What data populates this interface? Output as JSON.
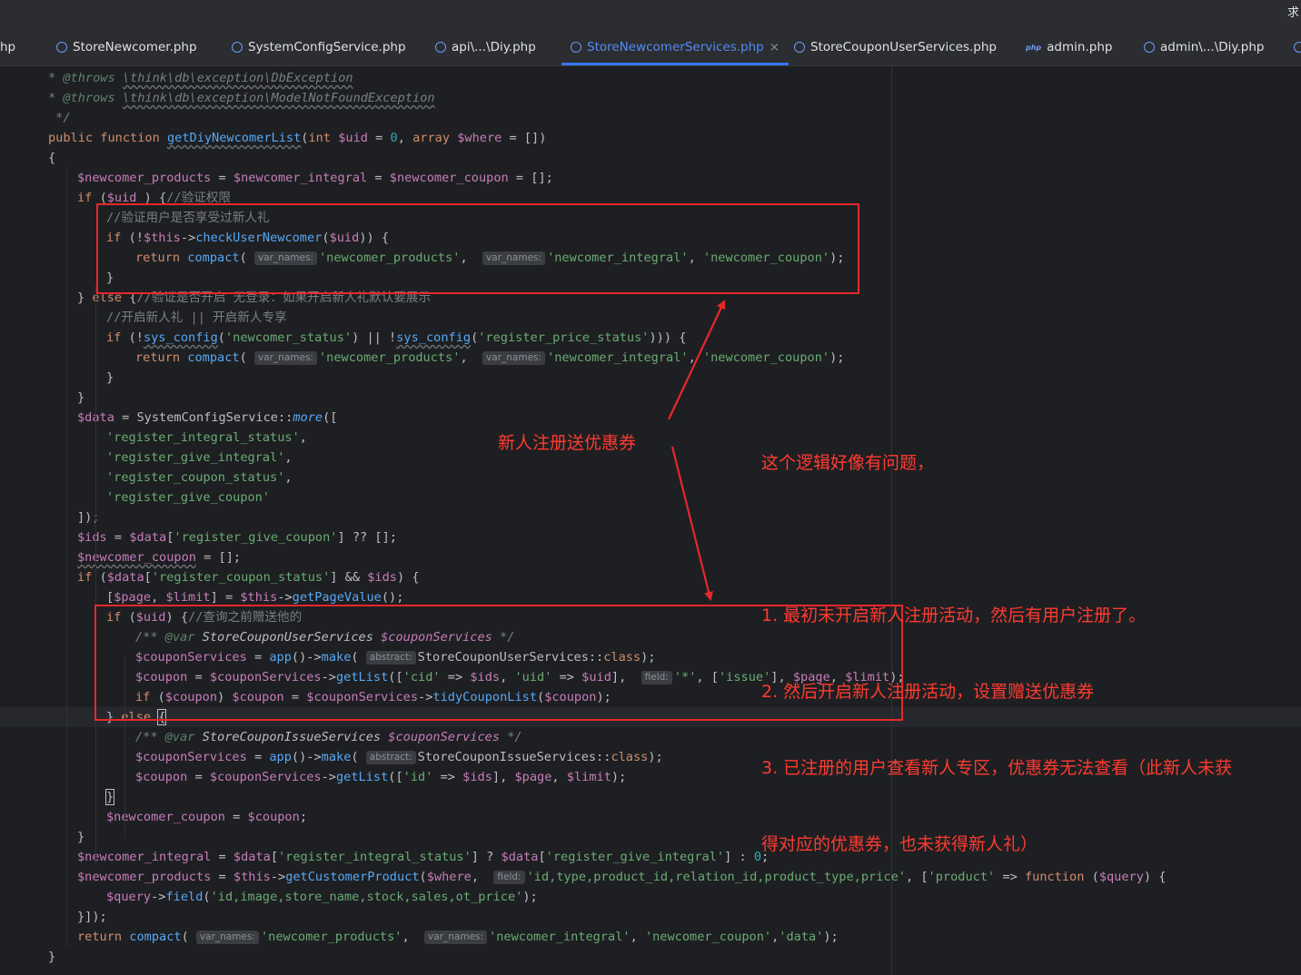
{
  "window": {
    "corner_glyph": "求"
  },
  "tabs": [
    {
      "label": "hp",
      "icon": "",
      "active": false
    },
    {
      "label": "StoreNewcomer.php",
      "icon": "php-class-icon",
      "active": false
    },
    {
      "label": "SystemConfigService.php",
      "icon": "php-class-icon",
      "active": false
    },
    {
      "label": "api\\...\\Diy.php",
      "icon": "php-class-icon",
      "active": false
    },
    {
      "label": "StoreNewcomerServices.php",
      "icon": "php-class-icon",
      "active": true,
      "close": "×"
    },
    {
      "label": "StoreCouponUserServices.php",
      "icon": "php-class-icon",
      "active": false
    },
    {
      "label": "admin.php",
      "icon": "php-file-icon",
      "icon_text": "php",
      "active": false
    },
    {
      "label": "admin\\...\\Diy.php",
      "icon": "php-class-icon",
      "active": false
    }
  ],
  "editor": {
    "hints": {
      "var_names": "var_names:",
      "abstract": "abstract:",
      "field": "field:"
    },
    "code": [
      [
        [
          "cmi",
          "* "
        ],
        [
          "tag",
          "@throws "
        ],
        [
          "cmi u",
          "\\think\\db\\exception\\DbException"
        ]
      ],
      [
        [
          "cmi",
          "* "
        ],
        [
          "tag",
          "@throws "
        ],
        [
          "cmi u",
          "\\think\\db\\exception\\ModelNotFoundException"
        ]
      ],
      [
        [
          "cmi",
          " */"
        ]
      ],
      [
        [
          "kw",
          "public function "
        ],
        [
          "fn u",
          "getDiyNewcomerList"
        ],
        [
          "",
          "("
        ],
        [
          "kw",
          "int "
        ],
        [
          "v",
          "$uid"
        ],
        [
          "",
          " = "
        ],
        [
          "n",
          "0"
        ],
        [
          "",
          ", "
        ],
        [
          "kw",
          "array "
        ],
        [
          "v",
          "$where"
        ],
        [
          "",
          " = [])"
        ]
      ],
      [
        [
          "",
          "{"
        ]
      ],
      [
        [
          "v",
          "$newcomer_products"
        ],
        [
          "",
          " = "
        ],
        [
          "v",
          "$newcomer_integral"
        ],
        [
          "",
          " = "
        ],
        [
          "v",
          "$newcomer_coupon"
        ],
        [
          "",
          " = [];"
        ]
      ],
      [
        [
          "kw",
          "if "
        ],
        [
          "",
          "("
        ],
        [
          "v",
          "$uid"
        ],
        [
          "",
          " ) {"
        ],
        [
          "cm",
          "//验证权限"
        ]
      ],
      [
        [
          "cm",
          "//验证用户是否享受过新人礼"
        ]
      ],
      [
        [
          "kw",
          "if "
        ],
        [
          "",
          "(!"
        ],
        [
          "v",
          "$this"
        ],
        [
          "",
          "->"
        ],
        [
          "fn",
          "checkUserNewcomer"
        ],
        [
          "",
          "("
        ],
        [
          "v",
          "$uid"
        ],
        [
          "",
          ")) {"
        ]
      ],
      [
        [
          "kw",
          "return "
        ],
        [
          "fn",
          "compact"
        ],
        [
          "",
          "( "
        ],
        [
          "hint",
          "var_names:"
        ],
        [
          "s",
          "'newcomer_products'"
        ],
        [
          "",
          ",  "
        ],
        [
          "hint",
          "var_names:"
        ],
        [
          "s",
          "'newcomer_integral'"
        ],
        [
          "",
          ", "
        ],
        [
          "s",
          "'newcomer_coupon'"
        ],
        [
          "",
          ");"
        ]
      ],
      [
        [
          "",
          "}"
        ]
      ],
      [
        [
          "",
          "} "
        ],
        [
          "kw",
          "else "
        ],
        [
          "",
          "{"
        ],
        [
          "cm",
          "//验证是否开启 无登录：如果开启新人礼默认要展示"
        ]
      ],
      [
        [
          "cm",
          "//开启新人礼 || 开启新人专享"
        ]
      ],
      [
        [
          "kw",
          "if "
        ],
        [
          "",
          "(!"
        ],
        [
          "fn u",
          "sys_config"
        ],
        [
          "",
          "("
        ],
        [
          "s",
          "'newcomer_status'"
        ],
        [
          "",
          ") || !"
        ],
        [
          "fn u",
          "sys_config"
        ],
        [
          "",
          "("
        ],
        [
          "s",
          "'register_price_status'"
        ],
        [
          "",
          "))) {"
        ]
      ],
      [
        [
          "kw",
          "return "
        ],
        [
          "fn",
          "compact"
        ],
        [
          "",
          "( "
        ],
        [
          "hint",
          "var_names:"
        ],
        [
          "s",
          "'newcomer_products'"
        ],
        [
          "",
          ",  "
        ],
        [
          "hint",
          "var_names:"
        ],
        [
          "s",
          "'newcomer_integral'"
        ],
        [
          "",
          ", "
        ],
        [
          "s",
          "'newcomer_coupon'"
        ],
        [
          "",
          ");"
        ]
      ],
      [
        [
          "",
          "}"
        ]
      ],
      [
        [
          "",
          "}"
        ]
      ],
      [
        [
          "v",
          "$data"
        ],
        [
          "",
          " = SystemConfigService::"
        ],
        [
          "fn it",
          "more"
        ],
        [
          "",
          "(["
        ]
      ],
      [
        [
          "s",
          "'register_integral_status'"
        ],
        [
          "",
          ","
        ]
      ],
      [
        [
          "s",
          "'register_give_integral'"
        ],
        [
          "",
          ","
        ]
      ],
      [
        [
          "s",
          "'register_coupon_status'"
        ],
        [
          "",
          ","
        ]
      ],
      [
        [
          "s",
          "'register_give_coupon'"
        ]
      ],
      [
        [
          "",
          "]);"
        ]
      ],
      [
        [
          "v",
          "$ids"
        ],
        [
          "",
          " = "
        ],
        [
          "v",
          "$data"
        ],
        [
          "",
          "["
        ],
        [
          "s",
          "'register_give_coupon'"
        ],
        [
          "",
          "] ?? [];"
        ]
      ],
      [
        [
          "v u",
          "$newcomer_coupon"
        ],
        [
          "",
          " = [];"
        ]
      ],
      [
        [
          "kw",
          "if "
        ],
        [
          "",
          "("
        ],
        [
          "v",
          "$data"
        ],
        [
          "",
          "["
        ],
        [
          "s",
          "'register_coupon_status'"
        ],
        [
          "",
          "] && "
        ],
        [
          "v",
          "$ids"
        ],
        [
          "",
          ") {"
        ]
      ],
      [
        [
          "",
          "["
        ],
        [
          "v",
          "$page"
        ],
        [
          "",
          ", "
        ],
        [
          "v",
          "$limit"
        ],
        [
          "",
          "] = "
        ],
        [
          "v",
          "$this"
        ],
        [
          "",
          "->"
        ],
        [
          "fn",
          "getPageValue"
        ],
        [
          "",
          "();"
        ]
      ],
      [
        [
          "kw",
          "if "
        ],
        [
          "",
          "("
        ],
        [
          "v",
          "$uid"
        ],
        [
          "",
          ") {"
        ],
        [
          "cm",
          "//查询之前赠送他的"
        ]
      ],
      [
        [
          "cmi",
          "/** "
        ],
        [
          "tag",
          "@var "
        ],
        [
          "it",
          "StoreCouponUserServices "
        ],
        [
          "v it",
          "$couponServices"
        ],
        [
          "cmi",
          " */"
        ]
      ],
      [
        [
          "v",
          "$couponServices"
        ],
        [
          "",
          " = "
        ],
        [
          "fn",
          "app"
        ],
        [
          "",
          "()->"
        ],
        [
          "fn",
          "make"
        ],
        [
          "",
          "( "
        ],
        [
          "hint",
          "abstract:"
        ],
        [
          "",
          "StoreCouponUserServices::"
        ],
        [
          "kw",
          "class"
        ],
        [
          "",
          ");"
        ]
      ],
      [
        [
          "v",
          "$coupon"
        ],
        [
          "",
          " = "
        ],
        [
          "v",
          "$couponServices"
        ],
        [
          "",
          "->"
        ],
        [
          "fn",
          "getList"
        ],
        [
          "",
          "(["
        ],
        [
          "s",
          "'cid'"
        ],
        [
          "",
          " => "
        ],
        [
          "v",
          "$ids"
        ],
        [
          "",
          ", "
        ],
        [
          "s",
          "'uid'"
        ],
        [
          "",
          " => "
        ],
        [
          "v",
          "$uid"
        ],
        [
          "",
          "],  "
        ],
        [
          "hint",
          "field:"
        ],
        [
          "s",
          "'*'"
        ],
        [
          "",
          ", ["
        ],
        [
          "s",
          "'issue'"
        ],
        [
          "",
          "], "
        ],
        [
          "v",
          "$page"
        ],
        [
          "",
          ", "
        ],
        [
          "v",
          "$limit"
        ],
        [
          "",
          ");"
        ]
      ],
      [
        [
          "kw",
          "if "
        ],
        [
          "",
          "("
        ],
        [
          "v",
          "$coupon"
        ],
        [
          "",
          ") "
        ],
        [
          "v",
          "$coupon"
        ],
        [
          "",
          " = "
        ],
        [
          "v",
          "$couponServices"
        ],
        [
          "",
          "->"
        ],
        [
          "fn",
          "tidyCouponList"
        ],
        [
          "",
          "("
        ],
        [
          "v",
          "$coupon"
        ],
        [
          "",
          ");"
        ]
      ],
      [
        [
          "",
          "} "
        ],
        [
          "kw",
          "else "
        ],
        [
          "cur",
          "{"
        ]
      ],
      [
        [
          "cmi",
          "/** "
        ],
        [
          "tag",
          "@var "
        ],
        [
          "it",
          "StoreCouponIssueServices "
        ],
        [
          "v it",
          "$couponServices"
        ],
        [
          "cmi",
          " */"
        ]
      ],
      [
        [
          "v",
          "$couponServices"
        ],
        [
          "",
          " = "
        ],
        [
          "fn",
          "app"
        ],
        [
          "",
          "()->"
        ],
        [
          "fn",
          "make"
        ],
        [
          "",
          "( "
        ],
        [
          "hint",
          "abstract:"
        ],
        [
          "",
          "StoreCouponIssueServices::"
        ],
        [
          "kw",
          "class"
        ],
        [
          "",
          ");"
        ]
      ],
      [
        [
          "v",
          "$coupon"
        ],
        [
          "",
          " = "
        ],
        [
          "v",
          "$couponServices"
        ],
        [
          "",
          "->"
        ],
        [
          "fn",
          "getList"
        ],
        [
          "",
          "(["
        ],
        [
          "s",
          "'id'"
        ],
        [
          "",
          " => "
        ],
        [
          "v",
          "$ids"
        ],
        [
          "",
          "], "
        ],
        [
          "v",
          "$page"
        ],
        [
          "",
          ", "
        ],
        [
          "v",
          "$limit"
        ],
        [
          "",
          ");"
        ]
      ],
      [
        [
          "cur",
          "}"
        ]
      ],
      [
        [
          "v",
          "$newcomer_coupon"
        ],
        [
          "",
          " = "
        ],
        [
          "v",
          "$coupon"
        ],
        [
          "",
          ";"
        ]
      ],
      [
        [
          "",
          "}"
        ]
      ],
      [
        [
          "v",
          "$newcomer_integral"
        ],
        [
          "",
          " = "
        ],
        [
          "v",
          "$data"
        ],
        [
          "",
          "["
        ],
        [
          "s",
          "'register_integral_status'"
        ],
        [
          "",
          "] ? "
        ],
        [
          "v",
          "$data"
        ],
        [
          "",
          "["
        ],
        [
          "s",
          "'register_give_integral'"
        ],
        [
          "",
          "] : "
        ],
        [
          "n",
          "0"
        ],
        [
          "",
          ";"
        ]
      ],
      [
        [
          "v",
          "$newcomer_products"
        ],
        [
          "",
          " = "
        ],
        [
          "v",
          "$this"
        ],
        [
          "",
          "->"
        ],
        [
          "fn",
          "getCustomerProduct"
        ],
        [
          "",
          "("
        ],
        [
          "v",
          "$where"
        ],
        [
          "",
          ",  "
        ],
        [
          "hint",
          "field:"
        ],
        [
          "s",
          "'id,type,product_id,relation_id,product_type,price'"
        ],
        [
          "",
          ", ["
        ],
        [
          "s",
          "'product'"
        ],
        [
          "",
          " => "
        ],
        [
          "kw",
          "function "
        ],
        [
          "",
          "("
        ],
        [
          "v",
          "$query"
        ],
        [
          "",
          ") {"
        ]
      ],
      [
        [
          "v",
          "$query"
        ],
        [
          "",
          "->"
        ],
        [
          "fn",
          "field"
        ],
        [
          "",
          "("
        ],
        [
          "s",
          "'id,image,store_name,stock,sales,ot_price'"
        ],
        [
          "",
          ");"
        ]
      ],
      [
        [
          "",
          "}]);"
        ]
      ],
      [
        [
          "kw",
          "return "
        ],
        [
          "fn",
          "compact"
        ],
        [
          "",
          "( "
        ],
        [
          "hint",
          "var_names:"
        ],
        [
          "s",
          "'newcomer_products'"
        ],
        [
          "",
          ",  "
        ],
        [
          "hint",
          "var_names:"
        ],
        [
          "s",
          "'newcomer_integral'"
        ],
        [
          "",
          ", "
        ],
        [
          "s",
          "'newcomer_coupon'"
        ],
        [
          "",
          ","
        ],
        [
          "s",
          "'data'"
        ],
        [
          "",
          ");"
        ]
      ],
      [
        [
          "",
          "}"
        ]
      ]
    ]
  },
  "annotations": {
    "label_left": "新人注册送优惠券",
    "note_lines": [
      "这个逻辑好像有问题，",
      "",
      "1. 最初未开启新人注册活动，然后有用户注册了。",
      "2. 然后开启新人注册活动，设置赠送优惠券",
      "3. 已注册的用户查看新人专区，优惠券无法查看（此新人未获",
      "得对应的优惠券，也未获得新人礼）"
    ]
  },
  "colors": {
    "background": "#1e1f22",
    "keyword": "#cf8e6d",
    "variable": "#c77dbb",
    "string": "#6aab73",
    "function": "#56a8f5",
    "comment": "#7a7e85",
    "annotation_red": "#e8272a",
    "active_tab": "#548af7"
  }
}
